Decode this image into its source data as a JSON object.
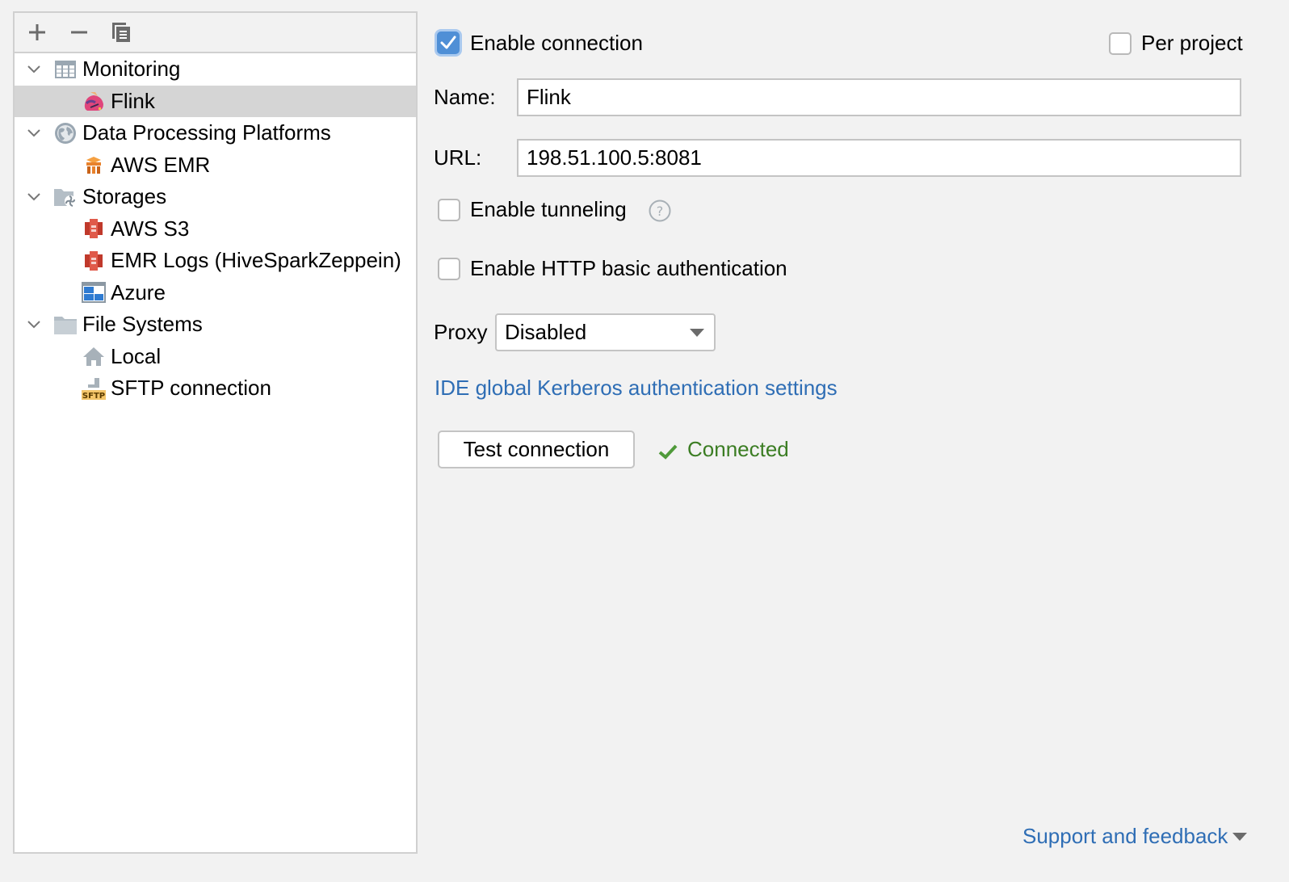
{
  "toolbar": {
    "add_icon": "plus-icon",
    "remove_icon": "minus-icon",
    "copy_icon": "copy-icon"
  },
  "tree": {
    "groups": [
      {
        "label": "Monitoring",
        "icon": "table-icon",
        "expanded": true,
        "children": [
          {
            "label": "Flink",
            "icon": "flink-squirrel-icon",
            "selected": true
          }
        ]
      },
      {
        "label": "Data Processing Platforms",
        "icon": "globe-icon",
        "expanded": true,
        "children": [
          {
            "label": "AWS EMR",
            "icon": "aws-emr-icon"
          }
        ]
      },
      {
        "label": "Storages",
        "icon": "storage-folder-icon",
        "expanded": true,
        "children": [
          {
            "label": "AWS S3",
            "icon": "aws-s3-icon"
          },
          {
            "label": "EMR Logs (HiveSparkZeppein)",
            "icon": "aws-s3-icon"
          },
          {
            "label": "Azure",
            "icon": "azure-icon"
          }
        ]
      },
      {
        "label": "File Systems",
        "icon": "folder-icon",
        "expanded": true,
        "children": [
          {
            "label": "Local",
            "icon": "home-icon"
          },
          {
            "label": "SFTP connection",
            "icon": "sftp-icon"
          }
        ]
      }
    ]
  },
  "form": {
    "enable_connection": {
      "label": "Enable connection",
      "checked": true
    },
    "per_project": {
      "label": "Per project",
      "checked": false
    },
    "name": {
      "label": "Name:",
      "value": "Flink"
    },
    "url": {
      "label": "URL:",
      "value": "198.51.100.5:8081"
    },
    "enable_tunneling": {
      "label": "Enable tunneling",
      "checked": false,
      "help_icon": "help-icon"
    },
    "enable_http_auth": {
      "label": "Enable HTTP basic authentication",
      "checked": false
    },
    "proxy": {
      "label": "Proxy",
      "value": "Disabled"
    },
    "kerberos_link": "IDE global Kerberos authentication settings",
    "test_button": "Test connection",
    "status": {
      "text": "Connected",
      "icon": "checkmark-icon",
      "color": "#3b7d23"
    },
    "support_link": "Support and feedback"
  },
  "colors": {
    "accent": "#4f8fd6",
    "link": "#2f6eb5",
    "selected_row": "#d5d5d5",
    "success": "#3b7d23"
  }
}
